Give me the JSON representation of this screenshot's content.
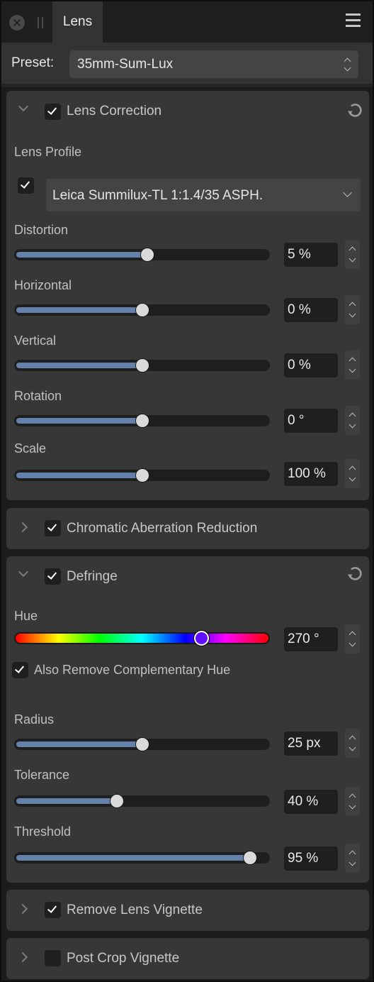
{
  "header": {
    "tab_label": "Lens",
    "icons": {
      "close": "close-icon",
      "grip": "drag-handle-icon",
      "menu": "hamburger-menu-icon"
    }
  },
  "preset": {
    "label": "Preset:",
    "value": "35mm-Sum-Lux"
  },
  "colors": {
    "slider_fill": "#6381aa",
    "panel_bg": "#373737",
    "hue_thumb": "#6010ff"
  },
  "sections": {
    "lens_correction": {
      "title": "Lens Correction",
      "enabled": true,
      "expanded": true,
      "lens_profile_label": "Lens Profile",
      "lens_profile_enabled": true,
      "lens_profile_value": "Leica Summilux-TL 1:1.4/35 ASPH.",
      "sliders": [
        {
          "label": "Distortion",
          "value": "5 %",
          "fraction": 0.52
        },
        {
          "label": "Horizontal",
          "value": "0 %",
          "fraction": 0.5
        },
        {
          "label": "Vertical",
          "value": "0 %",
          "fraction": 0.5
        },
        {
          "label": "Rotation",
          "value": "0 °",
          "fraction": 0.5
        },
        {
          "label": "Scale",
          "value": "100 %",
          "fraction": 0.5
        }
      ]
    },
    "chromatic_aberration": {
      "title": "Chromatic Aberration Reduction",
      "enabled": true,
      "expanded": false
    },
    "defringe": {
      "title": "Defringe",
      "enabled": true,
      "expanded": true,
      "hue": {
        "label": "Hue",
        "value": "270 °",
        "fraction": 0.735
      },
      "also_remove_label": "Also Remove Complementary Hue",
      "also_remove_checked": true,
      "sliders": [
        {
          "label": "Radius",
          "value": "25 px",
          "fraction": 0.5
        },
        {
          "label": "Tolerance",
          "value": "40 %",
          "fraction": 0.4
        },
        {
          "label": "Threshold",
          "value": "95 %",
          "fraction": 0.93
        }
      ]
    },
    "remove_lens_vignette": {
      "title": "Remove Lens Vignette",
      "enabled": true,
      "expanded": false
    },
    "post_crop_vignette": {
      "title": "Post Crop Vignette",
      "enabled": false,
      "expanded": false
    }
  }
}
